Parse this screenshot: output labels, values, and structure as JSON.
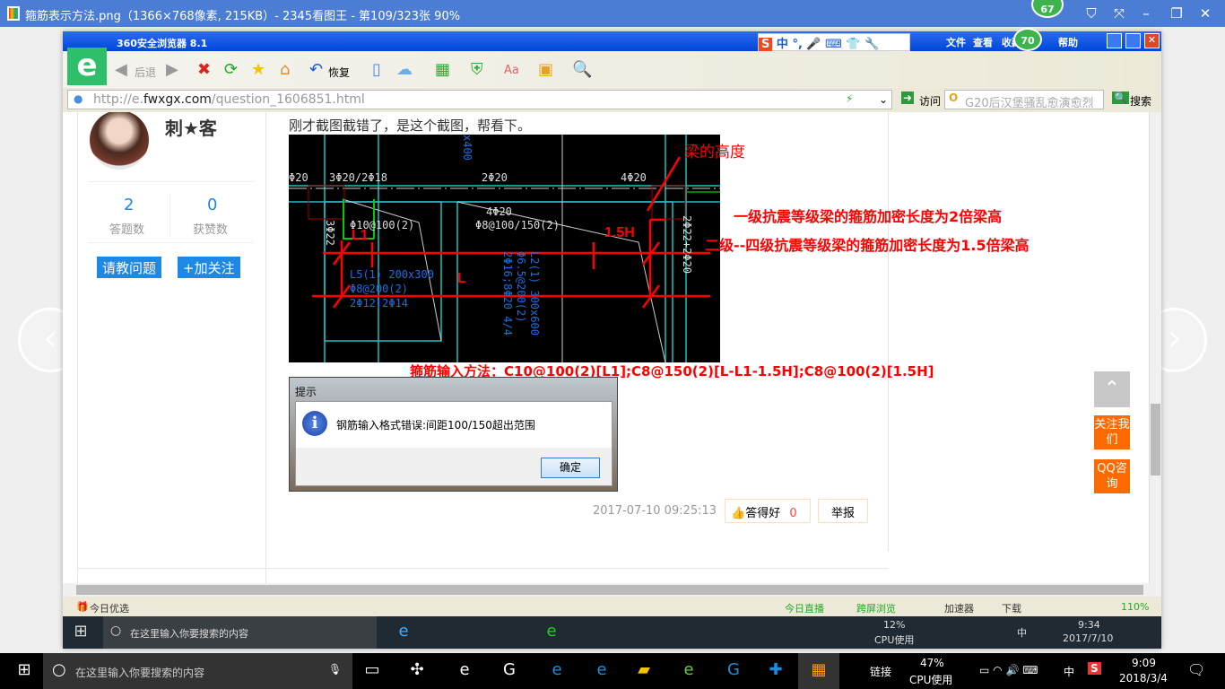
{
  "viewer": {
    "title": "箍筋表示方法.png（1366×768像素, 215KB）- 2345看图王 - 第109/323张 90%",
    "badge": "67"
  },
  "browser": {
    "title": "360安全浏览器 8.1",
    "menu": [
      "文件",
      "查看",
      "收藏",
      "帮助"
    ],
    "badge": "70",
    "ime": [
      "中",
      "°,"
    ],
    "toolbar": {
      "back": "后退",
      "restore": "恢复"
    },
    "url": {
      "prefix": "http://e.",
      "domain": "fwxgx.com",
      "path": "/question_1606851.html"
    },
    "go": "访问",
    "search_value": "G20后汉堡骚乱愈演愈烈",
    "search_btn": "搜索"
  },
  "profile": {
    "name": "刺★客",
    "stats": [
      {
        "value": "2",
        "label": "答题数"
      },
      {
        "value": "0",
        "label": "获赞数"
      }
    ],
    "ask_btn": "请教问题",
    "follow_btn": "+加关注"
  },
  "post": {
    "text": "刚才截图截错了，是这个截图，帮看下。",
    "annotations": {
      "beam_height": "梁的高度",
      "level1": "一级抗震等级梁的箍筋加密长度为2倍梁高",
      "level2": "二级--四级抗震等级梁的箍筋加密长度为1.5倍梁高",
      "method": "箍筋输入方法：C10@100(2)[L1];C8@150(2)[L-L1-1.5H];C8@100(2)[1.5H]",
      "L1": "L1",
      "L": "L",
      "H15": "1.5H"
    },
    "cad": {
      "t1": "3Φ20/2Φ18",
      "t2": "2Φ20",
      "t3": "4Φ20",
      "t4": "Φ10@100(2)",
      "t5": "4Φ20",
      "t6": "Φ8@100/150(2)",
      "t7": "L5(1) 200x300",
      "t8": "Φ8@200(2)",
      "t9": "2Φ12;2Φ14",
      "t10": "L2(1) 300x600",
      "t11": "Φ6.5@200(2)",
      "t12": "2Φ16;8Φ20 4/4",
      "t13": "2Φ22+2Φ20",
      "t14": "3Φ22",
      "t15": "Φ20",
      "t16": "x400"
    },
    "dialog": {
      "title": "提示",
      "message": "钢筋输入格式错误:间距100/150超出范围",
      "ok": "确定"
    },
    "time": "2017-07-10 09:25:13",
    "like_label": "答得好",
    "like_count": "0",
    "report": "举报"
  },
  "side": {
    "follow": "关注我们",
    "qq": "QQ咨询"
  },
  "status": {
    "left": "今日优选",
    "items": [
      "今日直播",
      "跨屏浏览",
      "加速器",
      "下载"
    ],
    "zoom": "110%"
  },
  "inner_taskbar": {
    "search": "在这里输入你要搜索的内容",
    "cpu": "12%",
    "cpu_label": "CPU使用",
    "ime": "中",
    "time": "9:34",
    "date": "2017/7/10"
  },
  "outer_taskbar": {
    "search": "在这里输入你要搜索的内容",
    "link": "链接",
    "cpu": "47%",
    "cpu_label": "CPU使用",
    "ime": "中",
    "time": "9:09",
    "date": "2018/3/4"
  }
}
